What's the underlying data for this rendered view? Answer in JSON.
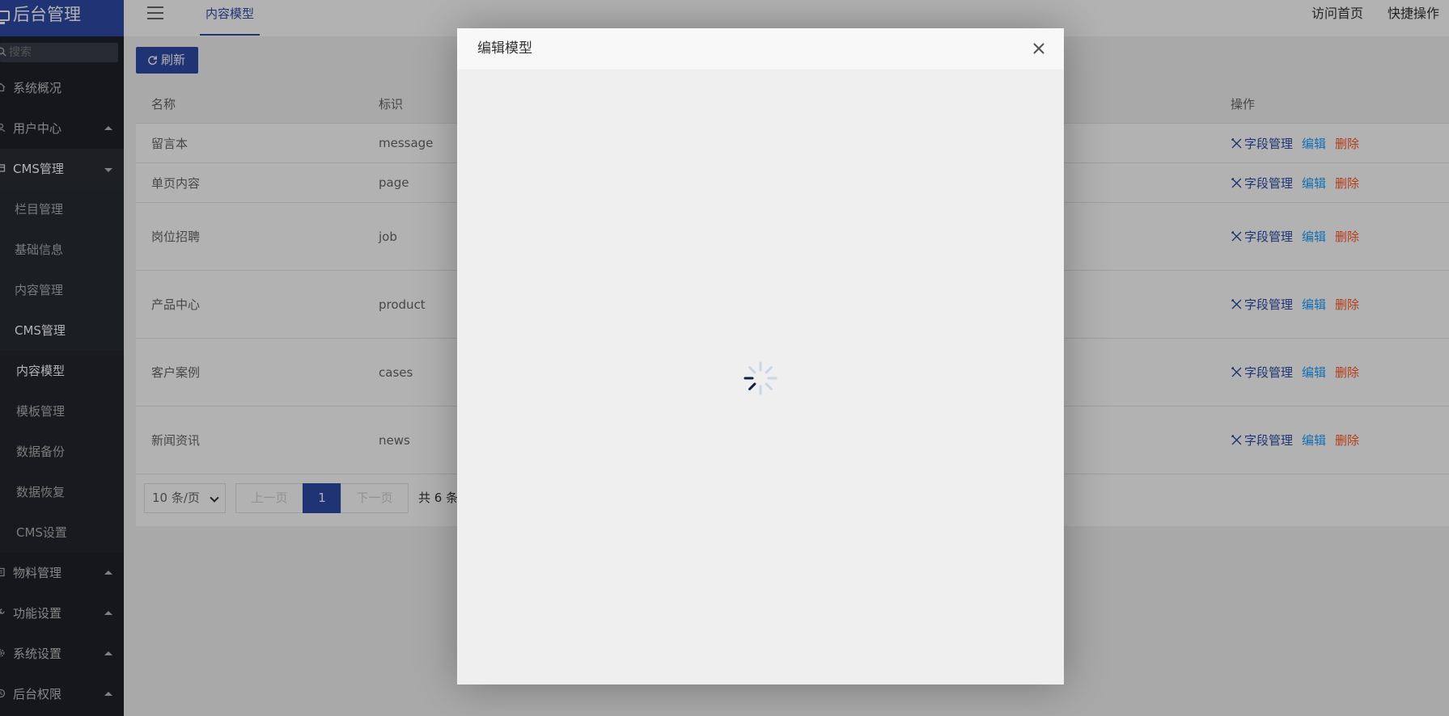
{
  "app": {
    "title": "后台管理"
  },
  "search": {
    "placeholder": "搜索"
  },
  "sidebar": {
    "items": [
      {
        "label": "系统概况"
      },
      {
        "label": "用户中心"
      },
      {
        "label": "CMS管理"
      },
      {
        "label": "栏目管理"
      },
      {
        "label": "基础信息"
      },
      {
        "label": "内容管理"
      },
      {
        "label": "CMS管理"
      },
      {
        "label": "内容模型"
      },
      {
        "label": "模板管理"
      },
      {
        "label": "数据备份"
      },
      {
        "label": "数据恢复"
      },
      {
        "label": "CMS设置"
      },
      {
        "label": "物料管理"
      },
      {
        "label": "功能设置"
      },
      {
        "label": "系统设置"
      },
      {
        "label": "后台权限"
      }
    ]
  },
  "topbar": {
    "tab": "内容模型",
    "visit_home": "访问首页",
    "quick_ops": "快捷操作"
  },
  "toolbar": {
    "refresh_label": "刷新"
  },
  "table": {
    "headers": {
      "name": "名称",
      "ident": "标识",
      "ops": "操作"
    },
    "ops": {
      "fields": "字段管理",
      "edit": "编辑",
      "delete": "删除"
    },
    "rows": [
      {
        "name": "留言本",
        "ident": "message"
      },
      {
        "name": "单页内容",
        "ident": "page"
      },
      {
        "name": "岗位招聘",
        "ident": "job"
      },
      {
        "name": "产品中心",
        "ident": "product"
      },
      {
        "name": "客户案例",
        "ident": "cases"
      },
      {
        "name": "新闻资讯",
        "ident": "news"
      }
    ]
  },
  "pager": {
    "per_page": "10 条/页",
    "prev": "上一页",
    "current": "1",
    "next": "下一页",
    "total": "共 6 条"
  },
  "modal": {
    "title": "编辑模型"
  },
  "colors": {
    "brand": "#2f4ba8",
    "edit": "#1e9fff",
    "delete": "#ff5722",
    "sidebar": "#20222a"
  }
}
